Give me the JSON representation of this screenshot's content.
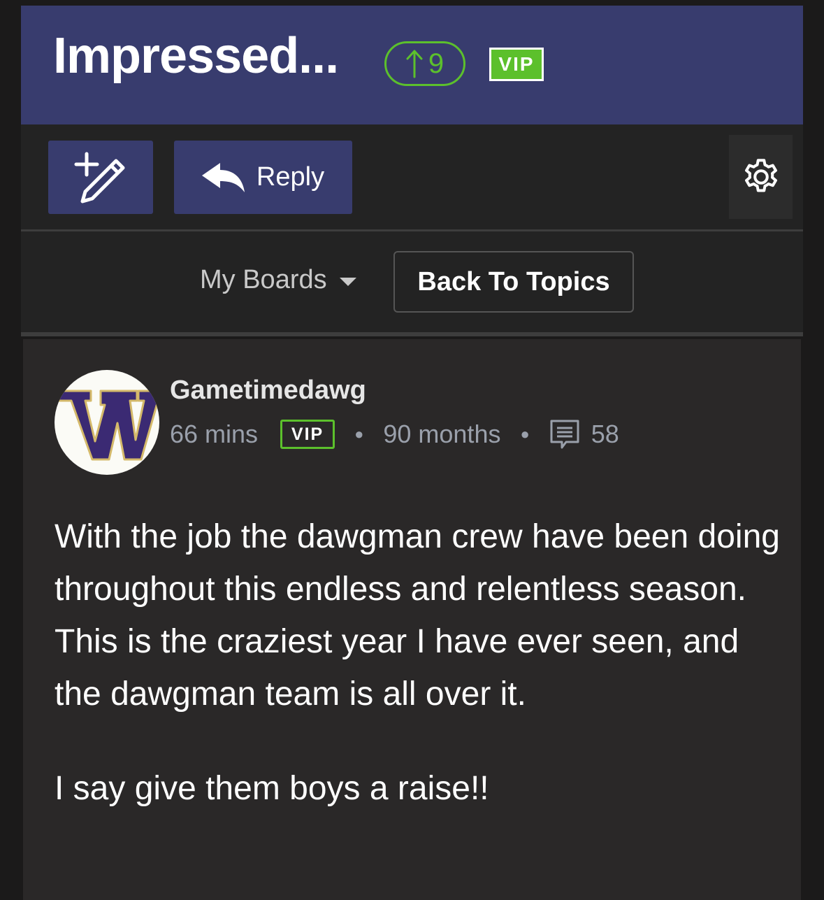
{
  "header": {
    "title": "Impressed...",
    "upvotes": "9",
    "vip_label": "VIP"
  },
  "toolbar": {
    "new_post_icon": "pencil-plus-icon",
    "reply_label": "Reply",
    "reply_icon": "reply-arrow-icon",
    "settings_icon": "gear-icon"
  },
  "nav": {
    "my_boards_label": "My Boards",
    "back_to_topics_label": "Back To Topics"
  },
  "post": {
    "username": "Gametimedawg",
    "posted_ago": "66 mins",
    "vip_label": "VIP",
    "member_duration": "90 months",
    "post_count": "58",
    "avatar_letter": "W",
    "body_paragraphs": [
      "With the job the dawgman crew have been doing throughout this endless and relentless season. This is the craziest year I have ever seen, and the dawgman team is all over it.",
      "I say give them boys a raise!!"
    ]
  },
  "colors": {
    "header_bg": "#383c6e",
    "accent_green": "#5cc02c",
    "page_bg": "#232323",
    "post_bg": "#2a2828"
  }
}
